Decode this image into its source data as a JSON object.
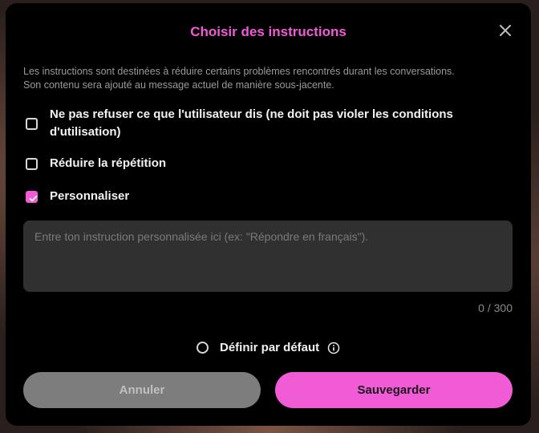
{
  "colors": {
    "accent": "#f25bd6",
    "modal_bg": "#000000",
    "cancel_bg": "#7d7d7d",
    "textarea_bg": "#303030"
  },
  "modal": {
    "title": "Choisir des instructions",
    "close_icon": "close-icon",
    "description_line1": "Les instructions sont destinées à réduire certains problèmes rencontrés durant les conversations.",
    "description_line2": "Son contenu sera ajouté au message actuel de manière sous-jacente.",
    "options": [
      {
        "label": "Ne pas refuser ce que l'utilisateur dis (ne doit pas violer les conditions d'utilisation)",
        "checked": false
      },
      {
        "label": "Réduire la répétition",
        "checked": false
      },
      {
        "label": "Personnaliser",
        "checked": true
      }
    ],
    "custom_instruction": {
      "value": "",
      "placeholder": "Entre ton instruction personnalisée ici (ex: \"Répondre en français\").",
      "counter": "0 / 300"
    },
    "default_option": {
      "label": "Définir par défaut",
      "checked": false,
      "info_icon": "info-icon"
    },
    "buttons": {
      "cancel": "Annuler",
      "save": "Sauvegarder"
    }
  }
}
